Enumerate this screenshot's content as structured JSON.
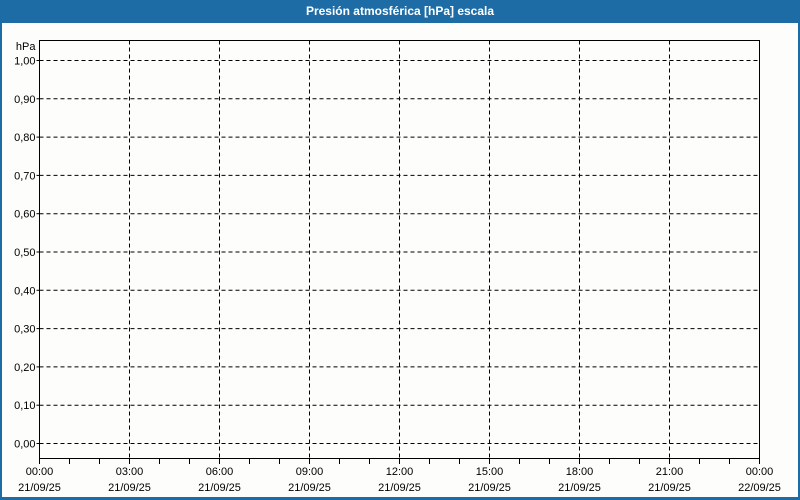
{
  "window": {
    "title": "Presión atmosférica [hPa] escala",
    "accent_color": "#1e6ca5",
    "plot_background": "#fdfdfc",
    "grid_color": "#000000",
    "text_color": "#000000"
  },
  "chart_data": {
    "type": "line",
    "title": "Presión atmosférica [hPa] escala",
    "ylabel": "hPa",
    "xlabel": "",
    "ylim": [
      0.0,
      1.0
    ],
    "y_tick_labels": [
      "1,00",
      "0,90",
      "0,80",
      "0,70",
      "0,60",
      "0,50",
      "0,40",
      "0,30",
      "0,20",
      "0,10",
      "0,00"
    ],
    "y_tick_values": [
      1.0,
      0.9,
      0.8,
      0.7,
      0.6,
      0.5,
      0.4,
      0.3,
      0.2,
      0.1,
      0.0
    ],
    "x_tick_labels": [
      {
        "time": "00:00",
        "date": "21/09/25"
      },
      {
        "time": "03:00",
        "date": "21/09/25"
      },
      {
        "time": "06:00",
        "date": "21/09/25"
      },
      {
        "time": "09:00",
        "date": "21/09/25"
      },
      {
        "time": "12:00",
        "date": "21/09/25"
      },
      {
        "time": "15:00",
        "date": "21/09/25"
      },
      {
        "time": "18:00",
        "date": "21/09/25"
      },
      {
        "time": "21:00",
        "date": "21/09/25"
      },
      {
        "time": "00:00",
        "date": "22/09/25"
      }
    ],
    "x_minor_ticks_between_majors": 2,
    "grid": "dashed",
    "legend_position": "none",
    "series": []
  }
}
